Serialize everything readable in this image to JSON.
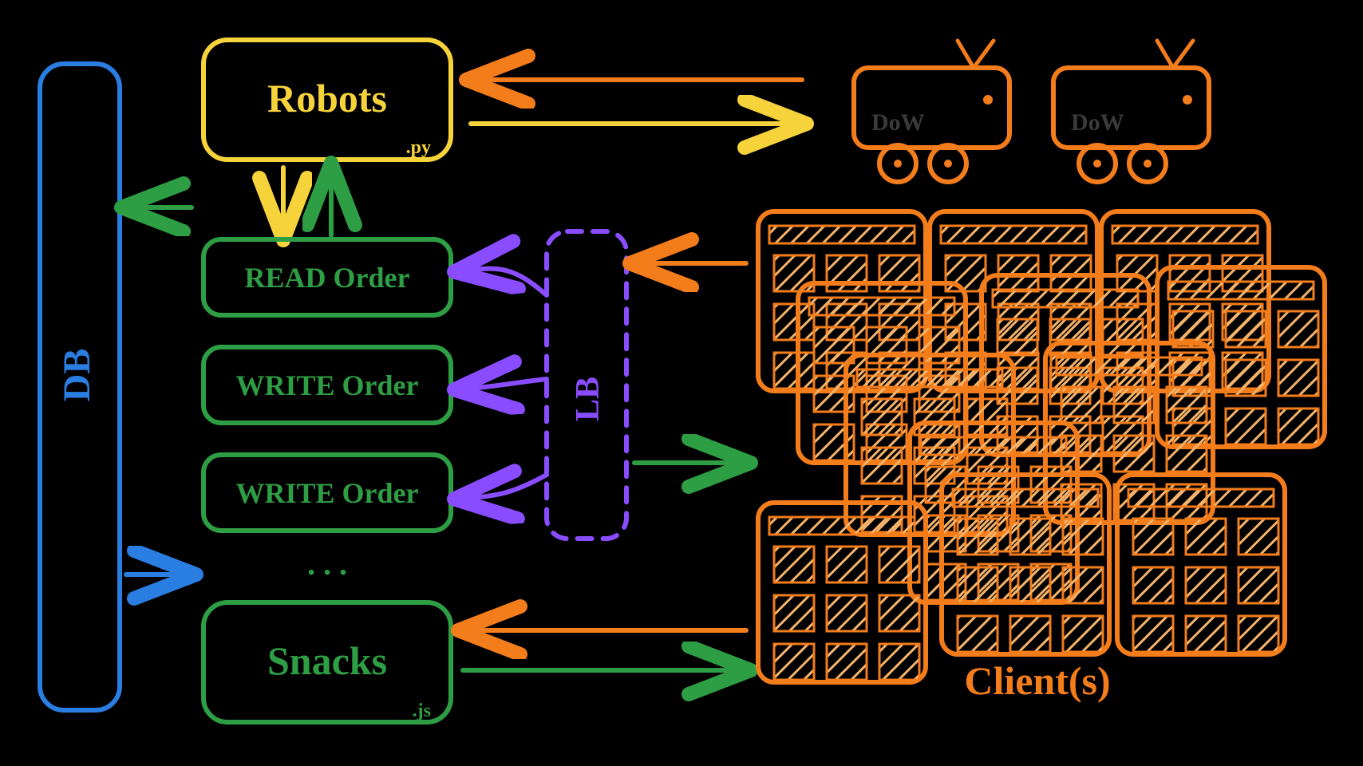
{
  "colors": {
    "yellow": "#f6d23b",
    "green": "#2e9e44",
    "blue": "#2a7de1",
    "orange": "#f37c1b",
    "purple": "#8a4cff",
    "gray": "#3a3a3a"
  },
  "db": {
    "label": "DB"
  },
  "robots": {
    "label": "Robots",
    "ext": ".py"
  },
  "api": {
    "read": "READ Order",
    "write1": "WRITE Order",
    "write2": "WRITE Order",
    "ellipsis": ". . ."
  },
  "snacks": {
    "label": "Snacks",
    "ext": ".js"
  },
  "lb": {
    "label": "LB"
  },
  "clients": {
    "label": "Client(s)"
  },
  "robot": {
    "label": "DoW"
  }
}
